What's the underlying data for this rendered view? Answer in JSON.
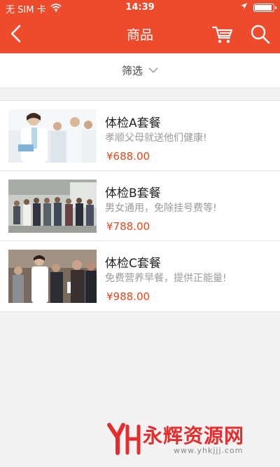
{
  "status_bar": {
    "carrier": "无 SIM 卡",
    "time": "14:39"
  },
  "header": {
    "title": "商品",
    "back_icon": "chevron-left-icon",
    "cart_icon": "cart-icon",
    "search_icon": "search-icon",
    "color": "#ee4a2c"
  },
  "filter": {
    "label": "筛选",
    "icon": "chevron-down-icon"
  },
  "products": [
    {
      "name": "体检A套餐",
      "desc": "孝顺父母就送他们健康!",
      "price": "¥688.00"
    },
    {
      "name": "体检B套餐",
      "desc": "男女通用，免除挂号费等!",
      "price": "¥788.00"
    },
    {
      "name": "体检C套餐",
      "desc": "免费营养早餐，提供正能量!",
      "price": "¥988.00"
    }
  ],
  "watermark": {
    "text": "永辉资源网",
    "url": "www.yhkjjj.com"
  }
}
